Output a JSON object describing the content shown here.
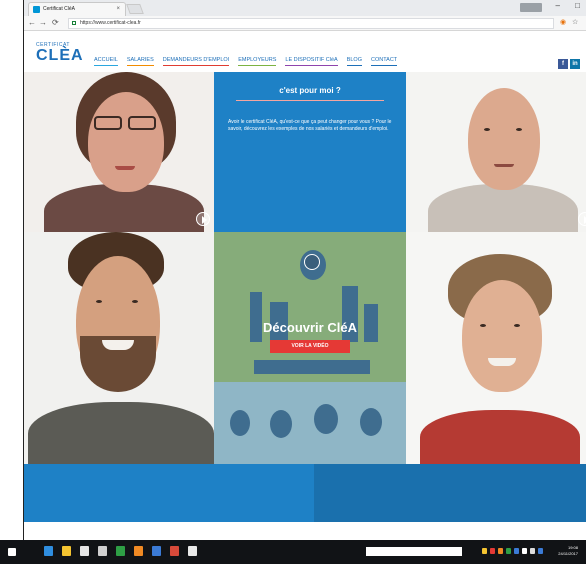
{
  "browser": {
    "tab_title": "Certificat CléA",
    "tab_close": "×",
    "url": "https://www.certificat-clea.fr",
    "window_user": "",
    "window_controls": [
      "–",
      "□"
    ]
  },
  "header": {
    "logo_top": "CERTIFICAT",
    "logo_main": "CLÈA",
    "nav": [
      "ACCUEIL",
      "SALARIES",
      "DEMANDEURS D'EMPLOI",
      "EMPLOYEURS",
      "LE DISPOSITIF CléA",
      "BLOG",
      "CONTACT"
    ],
    "social": [
      "f",
      "in"
    ],
    "colors": {
      "brand": "#1d6fb8",
      "facebook": "#3b5998",
      "linkedin": "#0e76a8"
    }
  },
  "intro_tile": {
    "title": "c'est pour moi ?",
    "text": "Avoir le certificat CléA, qu'est-ce que ça peut changer pour vous ? Pour le savoir, découvrez les exemples de nos salariés et demandeurs d'emploi."
  },
  "video_tile": {
    "title": "Découvrir CléA",
    "button": "VOIR LA VIDÉO"
  },
  "taskbar": {
    "clock_time": "19:08",
    "clock_date": "24/11/2017"
  }
}
